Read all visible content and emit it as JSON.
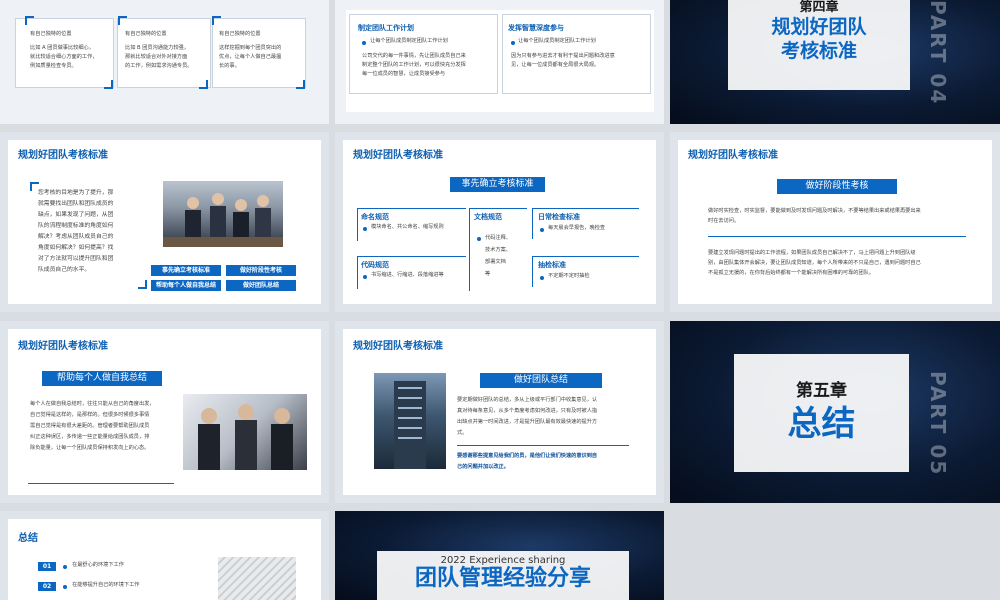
{
  "s1": {
    "cards": [
      {
        "t1": "有自己独特的位置",
        "t2": "比如 A 团员做事比较细心，",
        "t3": "就比较适合细心方面的工作，",
        "t4": "例如质量检查专员。"
      },
      {
        "t1": "有自己独特的位置",
        "t2": "比如 B 团员沟通能力较强，",
        "t3": "那就比较适合对外对接方面",
        "t4": "的工作，例如需求沟通专员。"
      },
      {
        "t1": "有自己独特的位置",
        "t2": "这样挖掘到每个团员突出的",
        "t3": "优点，让每个人做自己最擅",
        "t4": "长的事。"
      }
    ]
  },
  "s2": {
    "left_head": "制定团队工作计划",
    "left_b1": "让每个团队成员制定团队工作计划",
    "left_p1": "公司交代的每一件事情，先让团队成员自己来",
    "left_p2": "制定整个团队的工作计划，可以很快充分发挥",
    "left_p3": "每一位成员的智慧，让成员接受参与",
    "right_head": "发挥智慧深度参与",
    "right_b1": "让每个团队成员制定团队工作计划",
    "right_p1": "因为只有参与进去才有利于提出问题和改进意",
    "right_p2": "见，让每一位成员都有全局很大局观。"
  },
  "s3": {
    "chapter": "第四章",
    "title1": "规划好团队",
    "title2": "考核标准",
    "part": "PART 04"
  },
  "s4": {
    "title": "规划好团队考核标准",
    "lines": [
      "您考核的目地是为了提升，那",
      "就需要找出团队和团队成员的",
      "缺点，如果发现了问题，从团",
      "队的流程制度标准的角度如何",
      "解决？考虑从团队成员自己的",
      "角度如何解决？如何提高？找",
      "对了方法就可以提升团队和团",
      "队成员自己的水平。"
    ],
    "btn1": "事先确立考核标准",
    "btn2": "做好阶段性考核",
    "btn3": "帮助每个人做自我总结",
    "btn4": "做好团队总结"
  },
  "s5": {
    "title": "规划好团队考核标准",
    "pill": "事先确立考核标准",
    "b1_head": "命名规范",
    "b1_t": "模块命名、共公命名、缩写规则",
    "b2_head": "文档规范",
    "b2_t1": "代码注释、",
    "b2_t2": "技术方案、",
    "b2_t3": "部署文档",
    "b2_t4": "等",
    "b3_head": "日常检查标准",
    "b3_t": "每天晨会早报告，晚检查",
    "b4_head": "代码规范",
    "b4_t": "书写缩进、行缩进、段落缩进等",
    "b5_head": "抽检标准",
    "b5_t": "不定期不定时抽检"
  },
  "s6": {
    "title": "规划好团队考核标准",
    "pill": "做好阶段性考核",
    "p1a": "做好时实检查，时实监督，要能做到及时发现问题及时解决，不要等结果出来或结果再要出来",
    "p1b": "时在去访问。",
    "p2a": "要建立发现问题时提出的工作流程，如果团队成员自己解决不了，马上把问题上升到团队级",
    "p2b": "别，由团队集体开会解决，要让团队成员知道，每个人所带来的不只是自己，遇到问题时自己",
    "p2c": "不是孤立无援的，在你背后始终都有一个能解决所有困难的可靠的团队。"
  },
  "s7": {
    "title": "规划好团队考核标准",
    "pill": "帮助每个人做自我总结",
    "lines": [
      "每个人在做自我总结时，往往只能从自己的角度出发，",
      "自己觉得是这样的，是那样的。但很多时候很多事情",
      "需自己觉得是有很大差距的。管理者要帮助团队成员",
      "纠正这种误区，多传递一些正能量给成团队成员，排",
      "除负能量，让每一个团队成员保持积发向上的心态。"
    ]
  },
  "s8": {
    "title": "规划好团队考核标准",
    "pill": "做好团队总结",
    "lines": [
      "要定期做好团队的总结，多从上级或平行部门中收集意见，认",
      "真对待每条意见，从多个角度考虑如何改进，只有及时被人指",
      "出缺点并第一时间改进，才是提升团队最有效最快速的提升方",
      "式。"
    ],
    "em1": "要感谢那些提意见给我们的员，是他们让我们快速的意识到自",
    "em2": "己的问题并加以改正。"
  },
  "s9": {
    "chapter": "第五章",
    "title": "总结",
    "part": "PART 05"
  },
  "s10": {
    "title": "总结",
    "n1": "01",
    "t1": "在最舒心的环境下工作",
    "n2": "02",
    "t2": "在能够提升自己的环境下工作"
  },
  "s11": {
    "line1": "2022 Experience sharing",
    "line2": "团队管理经验分享"
  }
}
